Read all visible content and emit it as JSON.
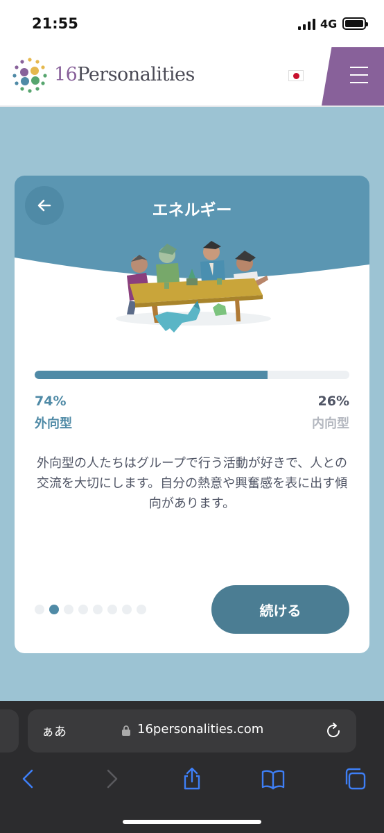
{
  "status_bar": {
    "time": "21:55",
    "network": "4G"
  },
  "header": {
    "logo_number": "16",
    "logo_word": "Personalities",
    "flag": "japan-flag",
    "menu_icon": "hamburger-menu-icon",
    "colors": {
      "brand_purple": "#88619a"
    }
  },
  "card": {
    "title": "エネルギー",
    "back_icon": "arrow-left-icon",
    "illustration": "people-around-table-illustration",
    "progress": {
      "value_percent": 74,
      "color": "#4f8aa6"
    },
    "left": {
      "percent": "74%",
      "label": "外向型"
    },
    "right": {
      "percent": "26%",
      "label": "内向型"
    },
    "description": "外向型の人たちはグループで行う活動が好きで、人との交流を大切にします。自分の熱意や興奮感を表に出す傾向があります。",
    "pagination": {
      "total": 8,
      "active_index": 1
    },
    "continue_label": "続ける"
  },
  "browser": {
    "text_size_label": "ぁあ",
    "url": "16personalities.com",
    "icons": [
      "back-chevron-icon",
      "forward-chevron-icon",
      "share-icon",
      "bookmarks-icon",
      "tabs-icon"
    ]
  }
}
